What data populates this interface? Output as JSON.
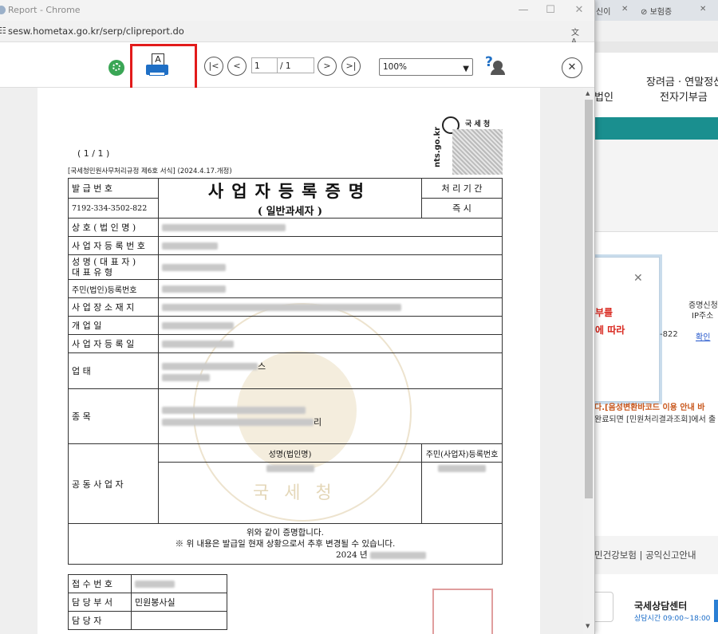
{
  "window": {
    "title": "Report - Chrome",
    "url": "sesw.hometax.go.kr/serp/clipreport.do",
    "minimize": "—",
    "maximize": "☐",
    "close": "✕"
  },
  "toolbar": {
    "page_current": "1",
    "page_total": "/ 1",
    "zoom": "100%",
    "close_label": "✕"
  },
  "document": {
    "page_indicator": "( 1 / 1 )",
    "regulation": "[국세청민원사무처리규정 제6호 서식] (2024.4.17.개정)",
    "agency_label": "국 세 청",
    "side_text": "nts.go.kr",
    "title": "사업자등록증명",
    "subtitle": "( 일반과세자 )",
    "issue_no_label": "발 급 번 호",
    "issue_no_value": "7192-334-3502-822",
    "processing_period_label": "처 리 기 간",
    "processing_period_value": "즉 시",
    "rows": {
      "trade_name": "상 호 ( 법 인 명 )",
      "biz_reg_no": "사 업 자 등 록 번 호",
      "representative": "성 명 ( 대 표 자 )",
      "rep_type": "대 표 유 형",
      "resident_no": "주민(법인)등록번호",
      "location": "사 업 장 소 재 지",
      "open_date": "개 업 일",
      "reg_date": "사 업 자 등 록 일",
      "business_type": "업 태",
      "business_type_suffix": "스",
      "category": "종 목",
      "category_suffix": "리",
      "co_owners": "공 동 사 업 자",
      "co_name_header": "성명(법인명)",
      "co_id_header": "주민(사업자)등록번호"
    },
    "certify_text": "위와 같이 증명합니다.",
    "note": "※ 위 내용은 발급일 현재 상황으로서 추후 변경될 수 있습니다.",
    "year": "2024 년",
    "receipt_no_label": "접 수 번 호",
    "dept_label": "담 당 부 서",
    "dept_value": "민원봉사실",
    "staff_label": "담 당 자",
    "watermark": "국 세 청"
  },
  "background_page": {
    "tab1": "신이",
    "tab2": "보험증",
    "nav1": "장려금 · 연말정산",
    "nav1b": "법인",
    "nav2": "전자기부금",
    "table_header": "증명신청",
    "table_header2": "IP주소",
    "table_cell": "-822",
    "link": "확인",
    "warning1": "부를",
    "warning2": "에 따라",
    "notice1": "다.[음성변환바코드 이용 안내 바",
    "notice2": "완료되면 [민원처리결과조회]에서 출",
    "footer_link": "민건강보험 | 공익신고안내",
    "call_center": "국세상담센터",
    "call_hours": "상담시간 09:00~18:00"
  },
  "colors": {
    "highlight": "#e21b1b",
    "teal_band": "#1a8f8f",
    "warning": "#d9281f"
  }
}
